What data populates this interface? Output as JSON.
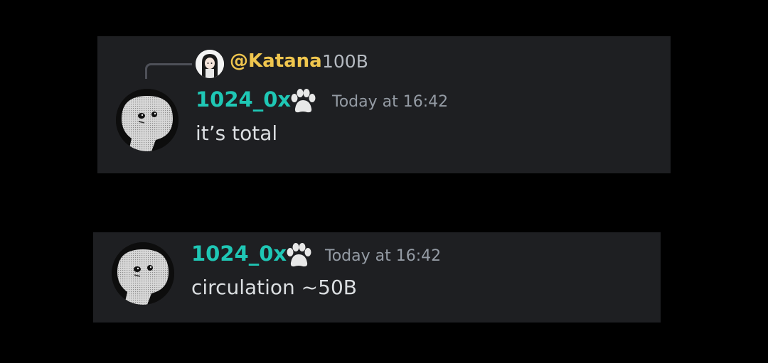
{
  "reply": {
    "name": "@Katana",
    "text": "100B"
  },
  "messages": [
    {
      "author": "1024_0x",
      "badge_icon": "paw-icon",
      "time": "Today at 16:42",
      "content": "it’s total"
    },
    {
      "author": "1024_0x",
      "badge_icon": "paw-icon",
      "time": "Today at 16:42",
      "content": "circulation ~50B"
    }
  ],
  "colors": {
    "background": "#000000",
    "message_background": "#1e1f22",
    "author_color": "#1fc7b5",
    "reply_name_color": "#f0c64e",
    "timestamp_color": "#949ba4",
    "content_color": "#dbdee1"
  }
}
